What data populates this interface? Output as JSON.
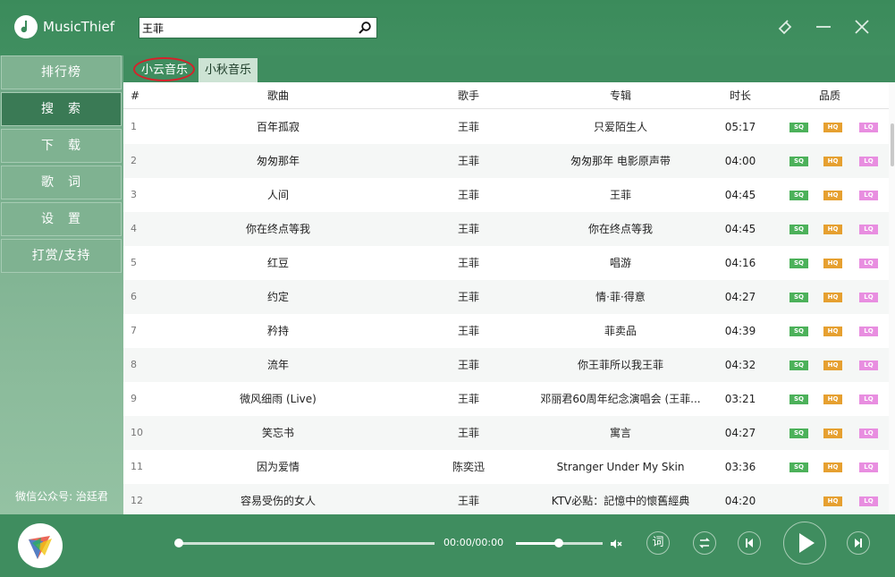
{
  "app": {
    "name": "MusicThief"
  },
  "search": {
    "value": "王菲"
  },
  "sidebar": {
    "items": [
      {
        "label": "排行榜"
      },
      {
        "label": "搜　索"
      },
      {
        "label": "下　载"
      },
      {
        "label": "歌　词"
      },
      {
        "label": "设　置"
      },
      {
        "label": "打赏/支持"
      }
    ],
    "active_index": 1,
    "footer": "微信公众号: 治廷君"
  },
  "source_tabs": [
    {
      "label": "小云音乐"
    },
    {
      "label": "小秋音乐"
    }
  ],
  "table": {
    "headers": {
      "index": "#",
      "song": "歌曲",
      "artist": "歌手",
      "album": "专辑",
      "duration": "时长",
      "quality": "品质"
    },
    "quality_labels": {
      "sq": "SQ",
      "hq": "HQ",
      "lq": "LQ"
    },
    "rows": [
      {
        "index": "1",
        "song": "百年孤寂",
        "artist": "王菲",
        "album": "只爱陌生人",
        "duration": "05:17",
        "sq": true
      },
      {
        "index": "2",
        "song": "匆匆那年",
        "artist": "王菲",
        "album": "匆匆那年 电影原声带",
        "duration": "04:00",
        "sq": true
      },
      {
        "index": "3",
        "song": "人间",
        "artist": "王菲",
        "album": "王菲",
        "duration": "04:45",
        "sq": true
      },
      {
        "index": "4",
        "song": "你在终点等我",
        "artist": "王菲",
        "album": "你在终点等我",
        "duration": "04:45",
        "sq": true
      },
      {
        "index": "5",
        "song": "红豆",
        "artist": "王菲",
        "album": "唱游",
        "duration": "04:16",
        "sq": true
      },
      {
        "index": "6",
        "song": "约定",
        "artist": "王菲",
        "album": "情·菲·得意",
        "duration": "04:27",
        "sq": true
      },
      {
        "index": "7",
        "song": "矜持",
        "artist": "王菲",
        "album": "菲卖品",
        "duration": "04:39",
        "sq": true
      },
      {
        "index": "8",
        "song": "流年",
        "artist": "王菲",
        "album": "你王菲所以我王菲",
        "duration": "04:32",
        "sq": true
      },
      {
        "index": "9",
        "song": "微风细雨 (Live)",
        "artist": "王菲",
        "album": "邓丽君60周年纪念演唱会 (王菲...",
        "duration": "03:21",
        "sq": true
      },
      {
        "index": "10",
        "song": "笑忘书",
        "artist": "王菲",
        "album": "寓言",
        "duration": "04:27",
        "sq": true
      },
      {
        "index": "11",
        "song": "因为爱情",
        "artist": "陈奕迅",
        "album": "Stranger Under My Skin",
        "duration": "03:36",
        "sq": true
      },
      {
        "index": "12",
        "song": "容易受伤的女人",
        "artist": "王菲",
        "album": "KTV必點：記憶中的懷舊經典",
        "duration": "04:20",
        "sq": false
      }
    ]
  },
  "player": {
    "time": "00:00/00:00",
    "progress": 0,
    "volume": 0.5,
    "lyrics_label": "词"
  },
  "colors": {
    "accent": "#3f8d5f",
    "sq": "#4cb15a",
    "hq": "#e6a030",
    "lq": "#e88ee0",
    "highlight_circle": "#d6212a"
  },
  "icons": {
    "logo": "music-note-icon",
    "search": "search-icon",
    "skin": "skin-icon",
    "minimize": "minimize-icon",
    "close": "close-icon",
    "volume": "volume-muted-icon",
    "loop": "repeat-icon",
    "prev": "previous-icon",
    "play": "play-icon",
    "next": "next-icon"
  }
}
